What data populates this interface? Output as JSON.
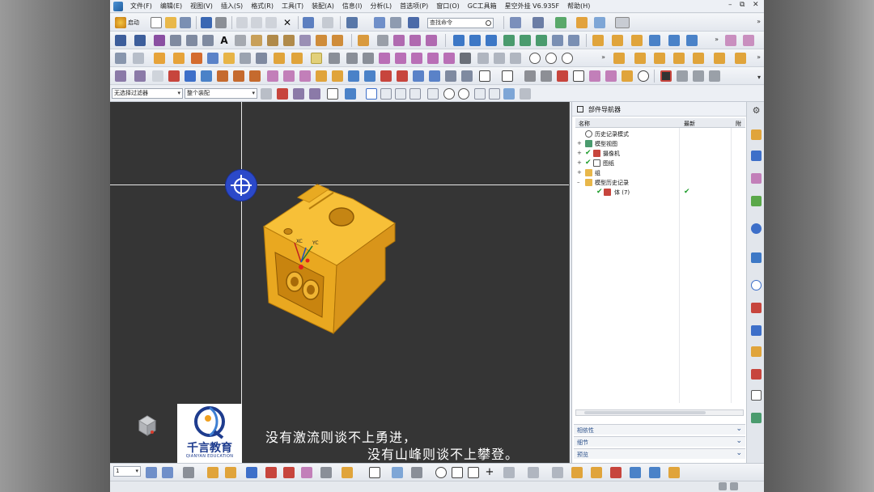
{
  "menu": {
    "items": [
      "文件(F)",
      "编辑(E)",
      "视图(V)",
      "插入(S)",
      "格式(R)",
      "工具(T)",
      "装配(A)",
      "信息(I)",
      "分析(L)",
      "首选项(P)",
      "窗口(O)",
      "GC工具箱",
      "星空外挂 V6.935F",
      "帮助(H)"
    ],
    "minimize": "–",
    "restore": "⧉",
    "close": "✕"
  },
  "toolbar": {
    "start_label": "启动",
    "search_placeholder": "查找命令"
  },
  "filters": {
    "selection_filter": "无选择过滤器",
    "assembly_scope": "整个装配"
  },
  "viewport": {
    "subtitle_line1": "没有激流则谈不上勇进，",
    "subtitle_line2": "没有山峰则谈不上攀登。",
    "logo_name": "千言教育",
    "logo_english": "QIANYAN EDUCATION",
    "axis_x": "XC",
    "axis_y": "YC",
    "model_color": "#f2b21e",
    "wcs_color": "#2b49c9"
  },
  "navigator": {
    "title": "部件导航器",
    "columns": {
      "name": "名称",
      "latest": "最新",
      "attach": "附"
    },
    "tree": [
      {
        "label": "历史记录模式",
        "expander": "",
        "checked": false,
        "latest": ""
      },
      {
        "label": "模型视图",
        "expander": "+",
        "checked": false,
        "latest": ""
      },
      {
        "label": "摄像机",
        "expander": "+",
        "checked": true,
        "latest": ""
      },
      {
        "label": "图纸",
        "expander": "+",
        "checked": true,
        "latest": ""
      },
      {
        "label": "组",
        "expander": "+",
        "checked": false,
        "latest": ""
      },
      {
        "label": "模型历史记录",
        "expander": "–",
        "checked": false,
        "latest": ""
      },
      {
        "label": "体 (7)",
        "expander": "",
        "checked": true,
        "latest": "✔"
      }
    ],
    "panels": [
      "相依性",
      "细节",
      "预览"
    ]
  },
  "bottom": {
    "layer_value": "1"
  },
  "colors": {
    "viewport_bg": "#353535",
    "check_green": "#1f9d2c",
    "logo_blue": "#1e3c8e"
  }
}
